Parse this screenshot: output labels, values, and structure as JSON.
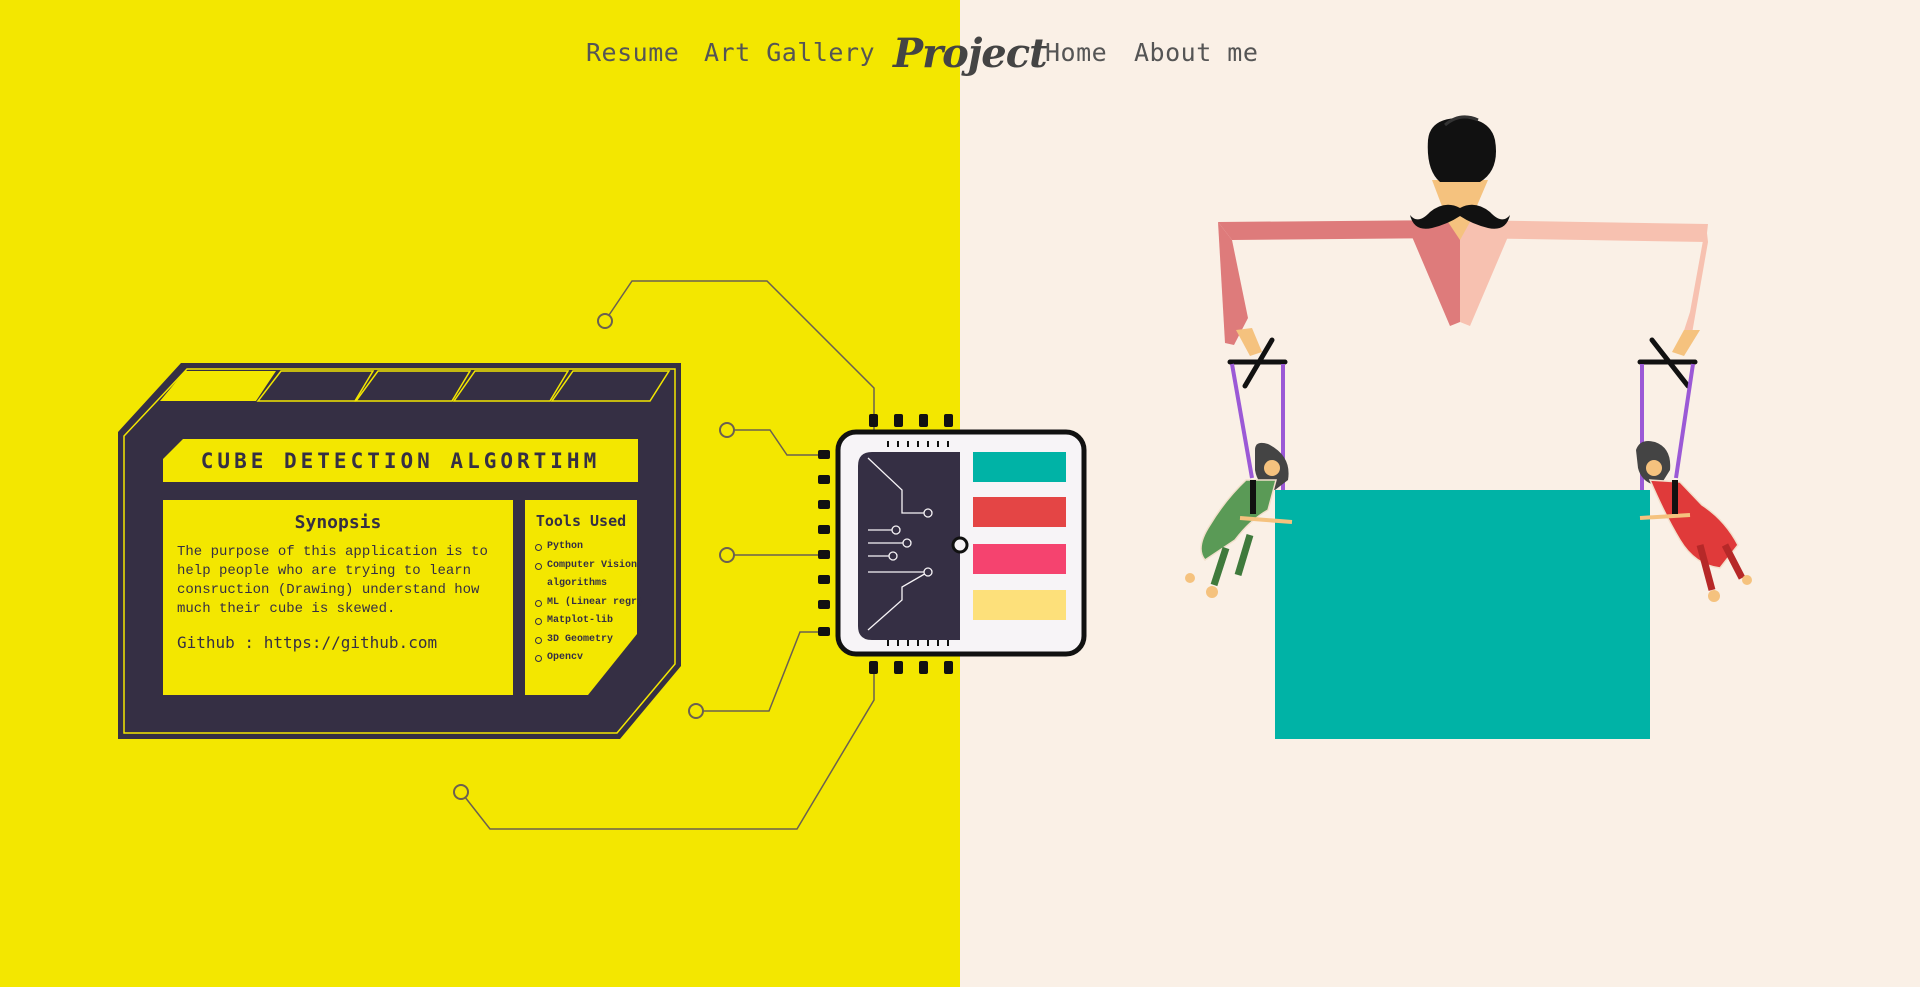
{
  "nav": {
    "brand": "Project",
    "items": [
      {
        "label": "Resume"
      },
      {
        "label": "Art Gallery"
      },
      {
        "label": "Home"
      },
      {
        "label": "About me"
      }
    ]
  },
  "card": {
    "title": "CUBE DETECTION ALGORTIHM",
    "synopsis_heading": "Synopsis",
    "synopsis_text": "The purpose of this application is to help people who are trying to learn consruction (Drawing) understand how much their cube is skewed.",
    "github": "Github : https://github.com",
    "tools_heading": "Tools Used",
    "tools": [
      "Python",
      "Computer Vision algorithms",
      "ML (Linear regr)",
      "Matplot-lib",
      "3D Geometry",
      "Opencv"
    ]
  },
  "colors": {
    "left_bg": "#f3e700",
    "right_bg": "#faf0e6",
    "dark": "#352f44",
    "teal": "#00b3a6",
    "red": "#e44545",
    "pink": "#f5436f",
    "yellow_bar": "#fde07a"
  },
  "illustration": {
    "left_scene": "circuit-chip",
    "right_scene": "puppeteer-with-marionettes"
  }
}
